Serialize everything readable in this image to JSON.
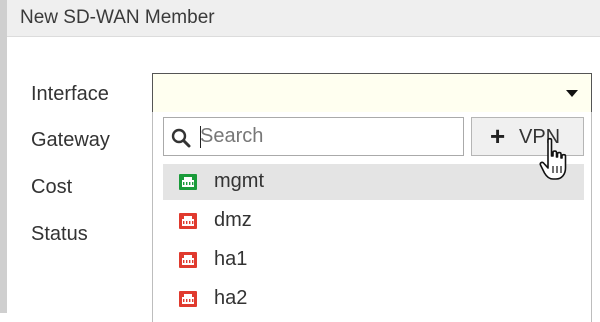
{
  "dialog": {
    "title": "New SD-WAN Member"
  },
  "form": {
    "labels": [
      "Interface",
      "Gateway",
      "Cost",
      "Status"
    ],
    "interface_value": ""
  },
  "dropdown": {
    "search_placeholder": "Search",
    "create_button_label": "VPN",
    "create_button_icon": "plus-icon",
    "options": [
      {
        "label": "mgmt",
        "icon": "ethernet-port-icon",
        "status_color": "#1a9b3a",
        "selected": true
      },
      {
        "label": "dmz",
        "icon": "ethernet-port-icon",
        "status_color": "#e03a2e",
        "selected": false
      },
      {
        "label": "ha1",
        "icon": "ethernet-port-icon",
        "status_color": "#e03a2e",
        "selected": false
      },
      {
        "label": "ha2",
        "icon": "ethernet-port-icon",
        "status_color": "#e03a2e",
        "selected": false
      }
    ]
  }
}
